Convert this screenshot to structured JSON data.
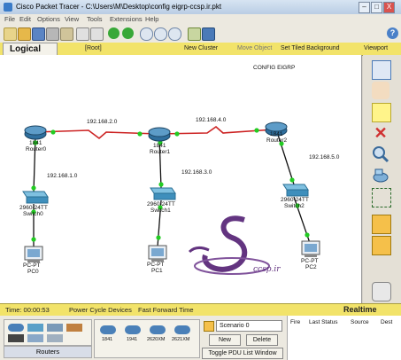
{
  "window": {
    "title": "Cisco Packet Tracer - C:\\Users\\M\\Desktop\\config eigrp-ccsp.ir.pkt",
    "minimize": "–",
    "maximize": "□",
    "close": "X"
  },
  "menu": [
    "File",
    "Edit",
    "Options",
    "View",
    "Tools",
    "Extensions",
    "Help"
  ],
  "logical_bar": {
    "tab": "Logical",
    "root": "[Root]",
    "new_cluster": "New Cluster",
    "move_object": "Move Object",
    "tiled_bg": "Set Tiled Background",
    "viewport": "Viewport"
  },
  "workspace": {
    "title": "CONFIG EIGRP",
    "networks": {
      "n1": "192.168.2.0",
      "n2": "192.168.4.0",
      "n3": "192.168.1.0",
      "n4": "192.168.3.0",
      "n5": "192.168.5.0"
    },
    "routers": [
      {
        "model": "1841",
        "name": "Router0"
      },
      {
        "model": "1841",
        "name": "Router1"
      },
      {
        "model": "1841",
        "name": "Router2"
      }
    ],
    "switches": [
      {
        "model": "2960-24TT",
        "name": "Switch0"
      },
      {
        "model": "2960-24TT",
        "name": "Switch1"
      },
      {
        "model": "2960-24TT",
        "name": "Switch2"
      }
    ],
    "pcs": [
      {
        "model": "PC-PT",
        "name": "PC0"
      },
      {
        "model": "PC-PT",
        "name": "PC1"
      },
      {
        "model": "PC-PT",
        "name": "PC2"
      }
    ]
  },
  "status": {
    "time": "Time: 00:00:53",
    "power_cycle": "Power Cycle Devices",
    "fast_forward": "Fast Forward Time",
    "mode": "Realtime"
  },
  "device_panel": {
    "category": "Routers",
    "models": [
      "1841",
      "1941",
      "2620XM",
      "2621XM"
    ]
  },
  "scenario": {
    "selected": "Scenario 0",
    "new": "New",
    "delete": "Delete",
    "toggle_pdu": "Toggle PDU List Window"
  },
  "pdu_headers": [
    "Fire",
    "Last Status",
    "Source",
    "Dest"
  ],
  "colors": {
    "serial_link": "#cc2222",
    "ethernet_link": "#111111",
    "link_up": "#22cc22",
    "router": "#2f6f9e",
    "switch": "#4b9fc8",
    "logical_bar": "#f2e36a"
  }
}
